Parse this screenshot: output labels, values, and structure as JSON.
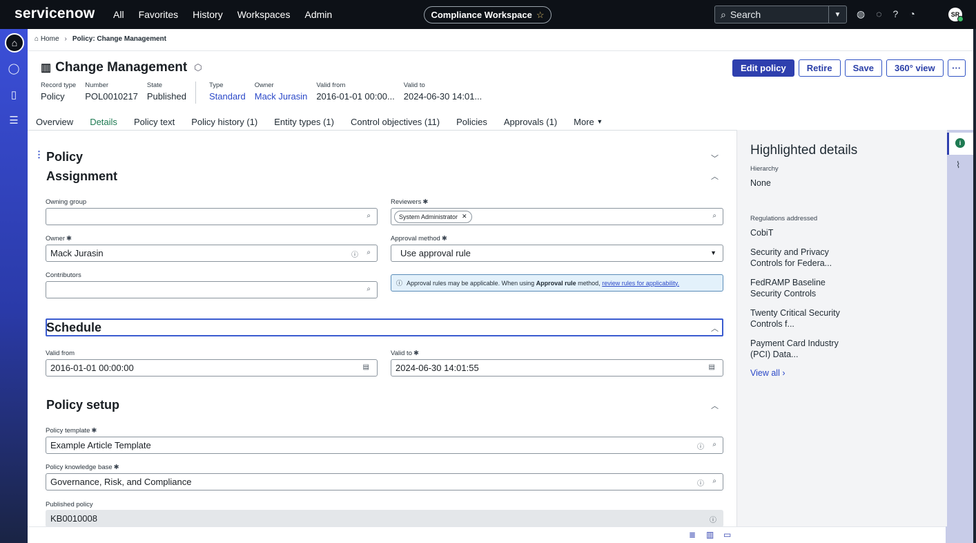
{
  "topnav": {
    "logo": "servicenow",
    "links": [
      "All",
      "Favorites",
      "History",
      "Workspaces",
      "Admin"
    ],
    "workspace": "Compliance Workspace",
    "search_placeholder": "Search",
    "avatar": "SR"
  },
  "breadcrumb": {
    "home": "Home",
    "current": "Policy: Change Management"
  },
  "record": {
    "title": "Change Management",
    "meta": [
      {
        "label": "Record type",
        "value": "Policy"
      },
      {
        "label": "Number",
        "value": "POL0010217"
      },
      {
        "label": "State",
        "value": "Published"
      },
      {
        "label": "Type",
        "value": "Standard"
      },
      {
        "label": "Owner",
        "value": "Mack Jurasin"
      },
      {
        "label": "Valid from",
        "value": "2016-01-01 00:00..."
      },
      {
        "label": "Valid to",
        "value": "2024-06-30 14:01..."
      }
    ]
  },
  "actions": {
    "edit": "Edit policy",
    "retire": "Retire",
    "save": "Save",
    "view360": "360° view",
    "more": "···"
  },
  "tabs": [
    "Overview",
    "Details",
    "Policy text",
    "Policy history (1)",
    "Entity types (1)",
    "Control objectives (11)",
    "Policies",
    "Approvals (1)",
    "More"
  ],
  "form": {
    "policy_heading": "Policy",
    "assignment_heading": "Assignment",
    "owning_group_label": "Owning group",
    "owning_group_value": "",
    "reviewers_label": "Reviewers",
    "reviewers_chip": "System Administrator",
    "owner_label": "Owner",
    "owner_value": "Mack Jurasin",
    "approval_method_label": "Approval method",
    "approval_method_value": "Use approval rule",
    "contributors_label": "Contributors",
    "contributors_value": "",
    "banner_prefix": "Approval rules may be applicable. When using",
    "banner_bold": "Approval rule",
    "banner_mid": "method,",
    "banner_link": "review rules for applicability.",
    "schedule_heading": "Schedule",
    "valid_from_label": "Valid from",
    "valid_from_value": "2016-01-01 00:00:00",
    "valid_to_label": "Valid to",
    "valid_to_value": "2024-06-30 14:01:55",
    "setup_heading": "Policy setup",
    "template_label": "Policy template",
    "template_value": "Example Article Template",
    "kb_label": "Policy knowledge base",
    "kb_value": "Governance, Risk, and Compliance",
    "published_label": "Published policy",
    "published_value": "KB0010008"
  },
  "highlights": {
    "title": "Highlighted details",
    "hierarchy_label": "Hierarchy",
    "hierarchy_value": "None",
    "regs_label": "Regulations addressed",
    "regs": [
      "CobiT",
      "Security and Privacy Controls for Federa...",
      "FedRAMP Baseline Security Controls",
      "Twenty Critical Security Controls f...",
      "Payment Card Industry (PCI) Data..."
    ],
    "view_all": "View all"
  }
}
